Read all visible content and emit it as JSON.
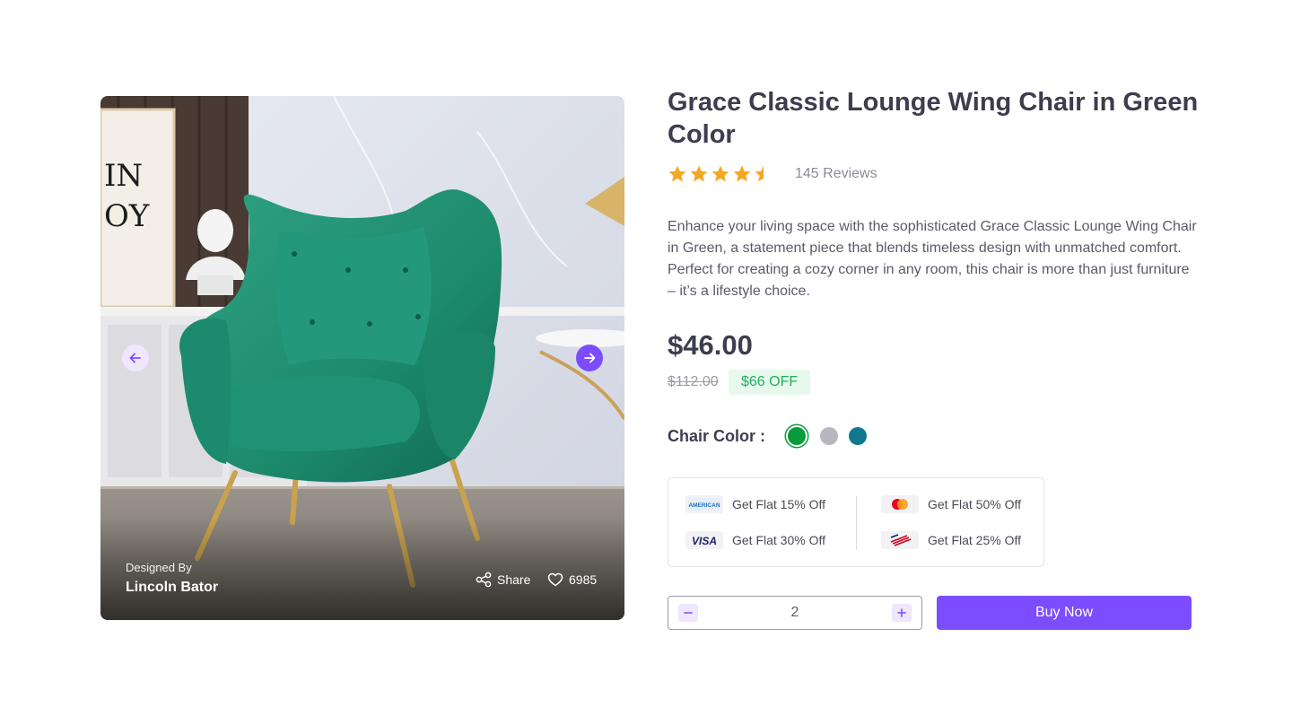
{
  "product": {
    "title": "Grace Classic Lounge Wing Chair in Green Color",
    "rating": 4.5,
    "rating_max": 5,
    "reviews_label": "145 Reviews",
    "description": "Enhance your living space with the sophisticated Grace Classic Lounge Wing Chair in Green, a statement piece that blends timeless design with unmatched comfort. Perfect for creating a cozy corner in any room, this chair is more than just furniture – it’s a lifestyle choice.",
    "price": "$46.00",
    "old_price": "$112.00",
    "discount": "$66 OFF"
  },
  "image": {
    "designed_by_label": "Designed By",
    "designer_name": "Lincoln Bator",
    "share_label": "Share",
    "likes": "6985",
    "prev_icon": "arrow-left-icon",
    "next_icon": "arrow-right-icon"
  },
  "colors": {
    "label": "Chair Color :",
    "options": [
      {
        "name": "green",
        "hex": "#0a9b3c",
        "selected": true
      },
      {
        "name": "gray",
        "hex": "#b7b7c2",
        "selected": false
      },
      {
        "name": "teal",
        "hex": "#127890",
        "selected": false
      }
    ]
  },
  "offers": [
    {
      "card": "american-express-icon",
      "text": "Get Flat 15% Off"
    },
    {
      "card": "visa-icon",
      "text": "Get Flat 30% Off"
    },
    {
      "card": "mastercard-icon",
      "text": "Get Flat 50% Off"
    },
    {
      "card": "bank-of-america-icon",
      "text": "Get Flat 25% Off"
    }
  ],
  "quantity": {
    "value": "2"
  },
  "actions": {
    "buy_label": "Buy Now"
  },
  "theme": {
    "accent": "#7c4dff",
    "star": "#f5a623",
    "discount_bg": "#e7f8ec",
    "discount_text": "#22b05b"
  }
}
